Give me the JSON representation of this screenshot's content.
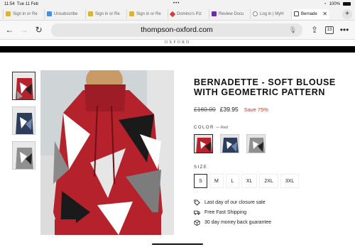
{
  "status": {
    "time": "11:54",
    "date": "Tue 11 Feb",
    "battery": "100%"
  },
  "tabs": [
    {
      "label": "Sign in or Re",
      "color": "#d9b43a"
    },
    {
      "label": "Unsubscribe",
      "color": "#4a90d9"
    },
    {
      "label": "Sign in or Re",
      "color": "#d9b43a"
    },
    {
      "label": "Sign in or Re",
      "color": "#d9b43a"
    },
    {
      "label": "Domino's Piz",
      "color": "#d43b3b"
    },
    {
      "label": "Review Docu",
      "color": "#6b2fa5"
    },
    {
      "label": "Log in | MyH",
      "color": "#888888"
    },
    {
      "label": "Bernade",
      "color": "#444444"
    }
  ],
  "toolbar": {
    "url": "thompson-oxford.com",
    "tab_count": "13"
  },
  "site": {
    "logo": "OXFORD"
  },
  "product": {
    "title": "BERNADETTE - SOFT BLOUSE WITH GEOMETRIC PATTERN",
    "old_price": "£160.00",
    "price": "£39.95",
    "save": "Save 75%",
    "color_label": "COLOR",
    "color_value": "— Red",
    "size_label": "SIZE",
    "sizes": [
      "S",
      "M",
      "L",
      "XL",
      "2XL",
      "3XL"
    ],
    "selected_size": "S",
    "perks": [
      {
        "icon": "tag-icon",
        "text": "Last day of our closure sale"
      },
      {
        "icon": "truck-icon",
        "text": "Free Fast Shipping"
      },
      {
        "icon": "box-icon",
        "text": "30 day money back guarantee"
      }
    ]
  },
  "colors": {
    "accent_red": "#b5222c",
    "navy": "#2f3d5c",
    "grey": "#8f8f8f",
    "sale": "#c0392b"
  }
}
